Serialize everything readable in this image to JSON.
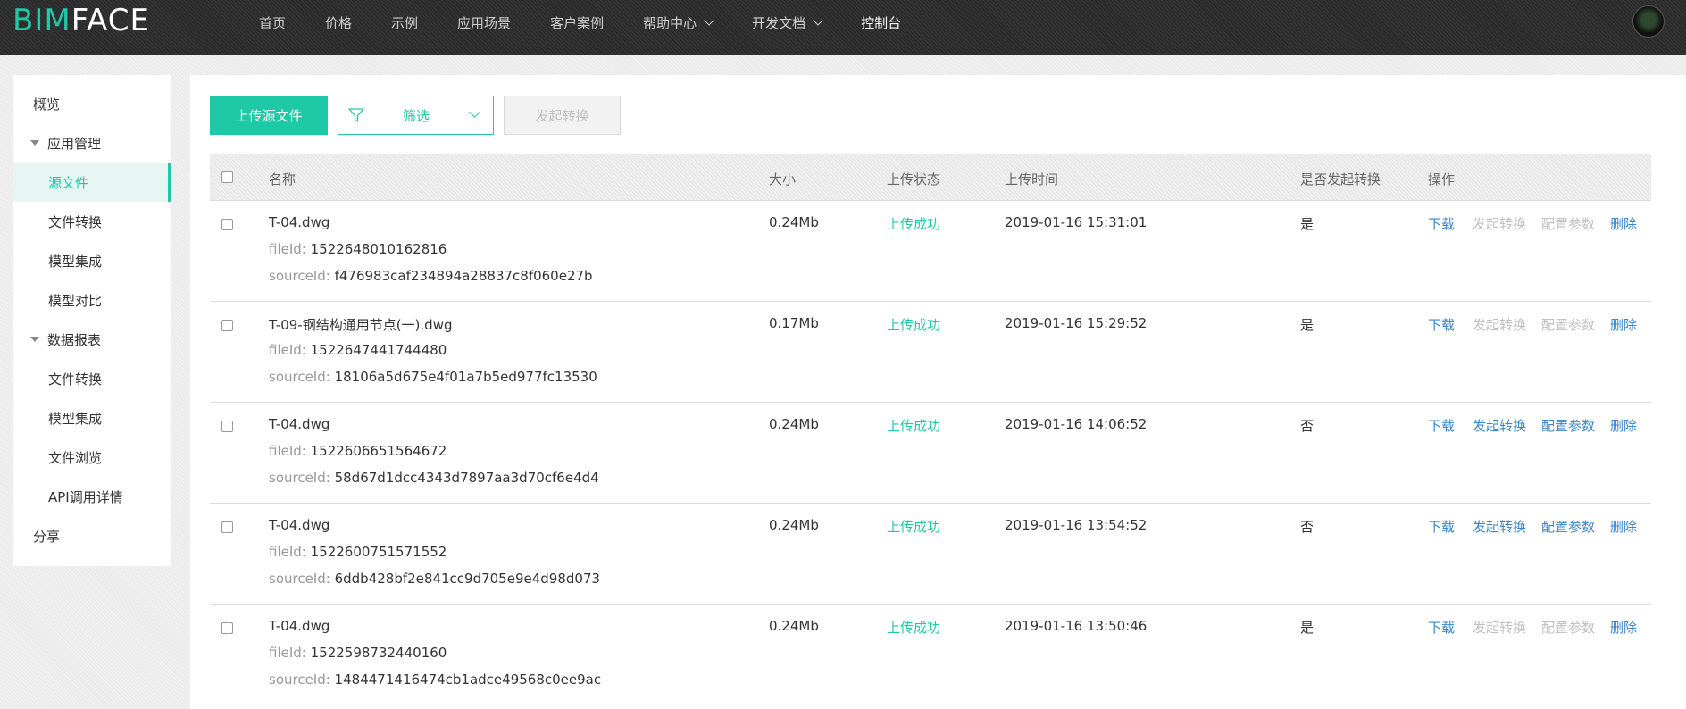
{
  "header": {
    "logo": {
      "part1": "BIM",
      "part2": "FACE"
    },
    "nav": [
      {
        "label": "首页",
        "dropdown": false,
        "active": false
      },
      {
        "label": "价格",
        "dropdown": false,
        "active": false
      },
      {
        "label": "示例",
        "dropdown": false,
        "active": false
      },
      {
        "label": "应用场景",
        "dropdown": false,
        "active": false
      },
      {
        "label": "客户案例",
        "dropdown": false,
        "active": false
      },
      {
        "label": "帮助中心",
        "dropdown": true,
        "active": false
      },
      {
        "label": "开发文档",
        "dropdown": true,
        "active": false
      },
      {
        "label": "控制台",
        "dropdown": false,
        "active": true
      }
    ]
  },
  "sidebar": {
    "items": [
      {
        "label": "概览",
        "kind": "top",
        "selected": false
      },
      {
        "label": "应用管理",
        "kind": "group",
        "selected": false
      },
      {
        "label": "源文件",
        "kind": "sub",
        "selected": true
      },
      {
        "label": "文件转换",
        "kind": "sub",
        "selected": false
      },
      {
        "label": "模型集成",
        "kind": "sub",
        "selected": false
      },
      {
        "label": "模型对比",
        "kind": "sub",
        "selected": false
      },
      {
        "label": "数据报表",
        "kind": "group",
        "selected": false
      },
      {
        "label": "文件转换",
        "kind": "sub",
        "selected": false
      },
      {
        "label": "模型集成",
        "kind": "sub",
        "selected": false
      },
      {
        "label": "文件浏览",
        "kind": "sub",
        "selected": false
      },
      {
        "label": "API调用详情",
        "kind": "sub",
        "selected": false
      },
      {
        "label": "分享",
        "kind": "top",
        "selected": false
      }
    ]
  },
  "toolbar": {
    "upload_label": "上传源文件",
    "filter_label": "筛选",
    "convert_label": "发起转换"
  },
  "table": {
    "headers": {
      "name": "名称",
      "size": "大小",
      "status": "上传状态",
      "time": "上传时间",
      "converted": "是否发起转换",
      "actions": "操作"
    },
    "meta_labels": {
      "file_id": "fileId:",
      "source_id": "sourceId:"
    },
    "action_labels": {
      "download": "下载",
      "convert": "发起转换",
      "config": "配置参数",
      "delete": "删除"
    },
    "rows": [
      {
        "name": "T-04.dwg",
        "file_id": "1522648010162816",
        "source_id": "f476983caf234894a28837c8f060e27b",
        "size": "0.24Mb",
        "status": "上传成功",
        "time": "2019-01-16 15:31:01",
        "converted": "是",
        "can_convert": false
      },
      {
        "name": "T-09-钢结构通用节点(一).dwg",
        "file_id": "1522647441744480",
        "source_id": "18106a5d675e4f01a7b5ed977fc13530",
        "size": "0.17Mb",
        "status": "上传成功",
        "time": "2019-01-16 15:29:52",
        "converted": "是",
        "can_convert": false
      },
      {
        "name": "T-04.dwg",
        "file_id": "1522606651564672",
        "source_id": "58d67d1dcc4343d7897aa3d70cf6e4d4",
        "size": "0.24Mb",
        "status": "上传成功",
        "time": "2019-01-16 14:06:52",
        "converted": "否",
        "can_convert": true
      },
      {
        "name": "T-04.dwg",
        "file_id": "1522600751571552",
        "source_id": "6ddb428bf2e841cc9d705e9e4d98d073",
        "size": "0.24Mb",
        "status": "上传成功",
        "time": "2019-01-16 13:54:52",
        "converted": "否",
        "can_convert": true
      },
      {
        "name": "T-04.dwg",
        "file_id": "1522598732440160",
        "source_id": "1484471416474cb1adce49568c0ee9ac",
        "size": "0.24Mb",
        "status": "上传成功",
        "time": "2019-01-16 13:50:46",
        "converted": "是",
        "can_convert": false
      }
    ]
  },
  "colors": {
    "accent": "#1ec9a8",
    "link": "#3a86c8",
    "disabled": "#c0c0c0",
    "topbar": "#2b2b2b"
  }
}
